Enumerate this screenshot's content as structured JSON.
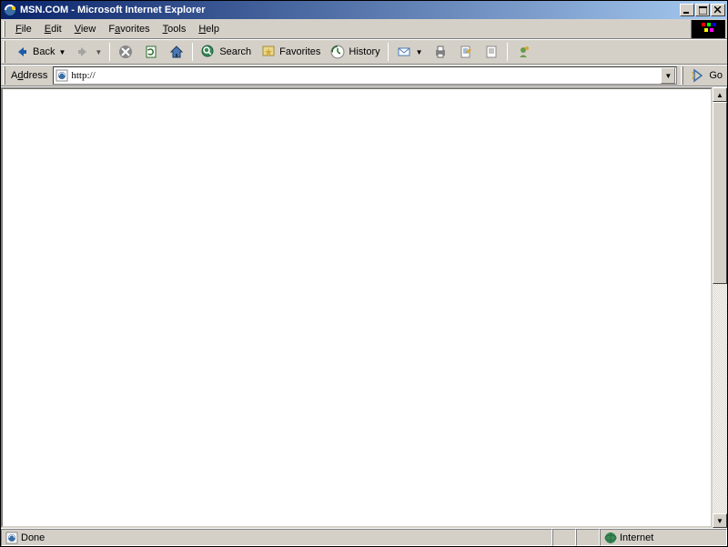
{
  "title": "MSN.COM - Microsoft Internet Explorer",
  "menus": {
    "file": "File",
    "edit": "Edit",
    "view": "View",
    "favorites": "Favorites",
    "tools": "Tools",
    "help": "Help"
  },
  "toolbar": {
    "back": "Back",
    "search": "Search",
    "favorites": "Favorites",
    "history": "History"
  },
  "address": {
    "label": "Address",
    "value": "http://",
    "go": "Go"
  },
  "status": {
    "text": "Done",
    "zone": "Internet"
  }
}
